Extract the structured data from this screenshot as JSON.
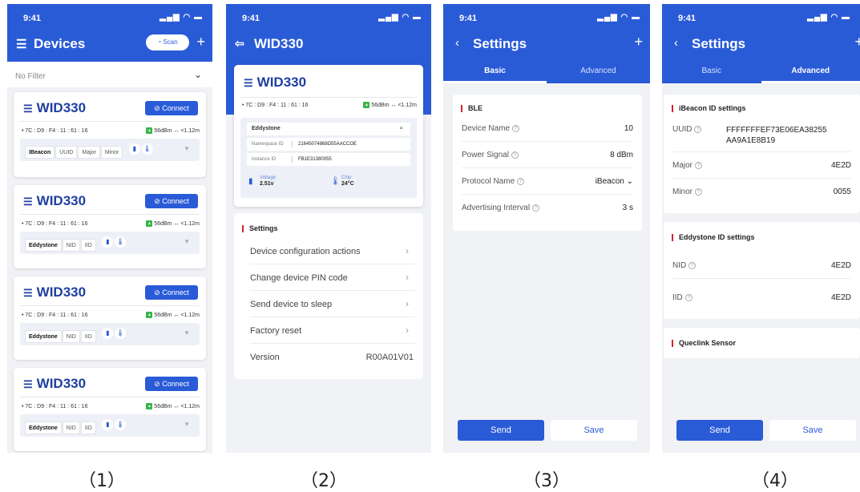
{
  "status": {
    "time": "9:41",
    "icons": "..ıl ᯤ ▬"
  },
  "screen1": {
    "title": "Devices",
    "scan_label": "Scan",
    "filter_label": "No Filter",
    "cards": [
      {
        "name": "WID330",
        "connect": "Connect",
        "mac": "• 7C : D9 : F4 : 11 : 61 : 16",
        "rssi": "56dBm ↔ <1.12m",
        "chips": [
          "IBeacon",
          "UUID",
          "Major",
          "Minor"
        ],
        "selected": 0
      },
      {
        "name": "WID330",
        "connect": "Connect",
        "mac": "• 7C : D9 : F4 : 11 : 61 : 16",
        "rssi": "56dBm ↔ <1.12m",
        "chips": [
          "Eddystone",
          "NID",
          "IID"
        ],
        "selected": 0
      },
      {
        "name": "WID330",
        "connect": "Connect",
        "mac": "• 7C : D9 : F4 : 11 : 61 : 16",
        "rssi": "56dBm ↔ <1.12m",
        "chips": [
          "Eddystone",
          "NID",
          "IID"
        ],
        "selected": 0
      },
      {
        "name": "WID330",
        "connect": "Connect",
        "mac": "• 7C : D9 : F4 : 11 : 61 : 16",
        "rssi": "56dBm ↔ <1.12m",
        "chips": [
          "Eddystone",
          "NID",
          "IID"
        ],
        "selected": 0
      }
    ]
  },
  "screen2": {
    "title": "WID330",
    "device_name": "WID330",
    "mac": "• 7C : D9 : F4 : 11 : 61 : 16",
    "rssi": "56dBm ↔ <1.12m",
    "eddystone_label": "Eddystone",
    "namespace_label": "Namespace ID",
    "namespace_value": "21645074868D55AACCOE",
    "instance_label": "Instance ID",
    "instance_value": "FB1E31380055",
    "voltage_label": "Voltage",
    "voltage_value": "2.51v",
    "chip_label": "Chip",
    "chip_value": "24°C",
    "settings_title": "Settings",
    "rows": [
      "Device configuration actions",
      "Change device PIN code",
      "Send device to sleep",
      "Factory reset"
    ],
    "version_label": "Version",
    "version_value": "R00A01V01"
  },
  "screen3": {
    "title": "Settings",
    "tab_basic": "Basic",
    "tab_advanced": "Advanced",
    "section": "BLE",
    "rows": [
      {
        "label": "Device Name",
        "value": "10"
      },
      {
        "label": "Power Signal",
        "value": "8 dBm"
      },
      {
        "label": "Protocol Name",
        "value": "iBeacon"
      },
      {
        "label": "Advertising Interval",
        "value": "3 s"
      }
    ],
    "send": "Send",
    "save": "Save"
  },
  "screen4": {
    "title": "Settings",
    "tab_basic": "Basic",
    "tab_advanced": "Advanced",
    "ibeacon_title": "iBeacon ID settings",
    "uuid_label": "UUID",
    "uuid_value": "FFFFFFFEF73E06EA38255AA9A1E8B19",
    "major_label": "Major",
    "major_value": "4E2D",
    "minor_label": "Minor",
    "minor_value": "0055",
    "eddystone_title": "Eddystone ID settings",
    "nid_label": "NID",
    "nid_value": "4E2D",
    "iid_label": "IID",
    "iid_value": "4E2D",
    "sensor_title": "Queclink Sensor",
    "send": "Send",
    "save": "Save"
  },
  "captions": [
    "（1）",
    "（2）",
    "（3）",
    "（4）"
  ],
  "colors": {
    "primary": "#2a5bd7",
    "accent_red": "#d6232a",
    "rssi_green": "#39b54a"
  }
}
